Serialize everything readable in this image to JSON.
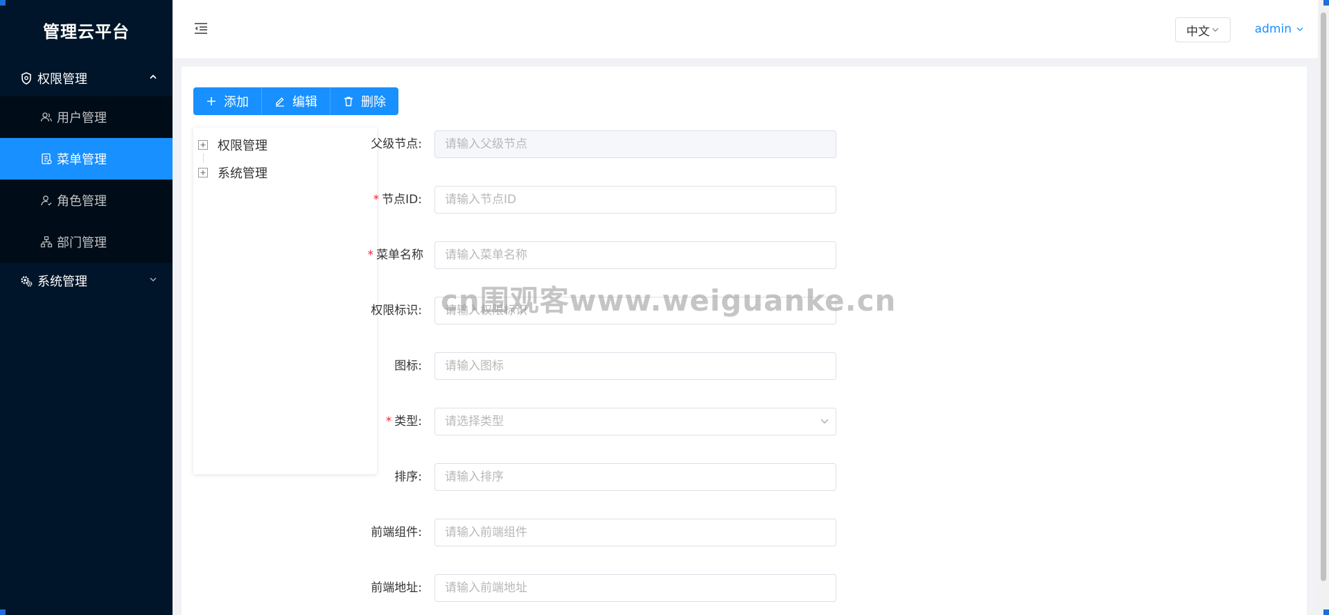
{
  "sidebar": {
    "logo": "管理云平台",
    "groups": [
      {
        "label": "权限管理",
        "icon": "shield-icon",
        "expanded": true,
        "items": [
          {
            "label": "用户管理",
            "icon": "user-icon",
            "active": false
          },
          {
            "label": "菜单管理",
            "icon": "menu-doc-icon",
            "active": true
          },
          {
            "label": "角色管理",
            "icon": "role-icon",
            "active": false
          },
          {
            "label": "部门管理",
            "icon": "org-icon",
            "active": false
          }
        ]
      },
      {
        "label": "系统管理",
        "icon": "gears-icon",
        "expanded": false,
        "items": []
      }
    ]
  },
  "header": {
    "language": "中文",
    "user": "admin"
  },
  "toolbar": {
    "add_label": "添加",
    "edit_label": "编辑",
    "delete_label": "删除"
  },
  "tree": {
    "nodes": [
      {
        "label": "权限管理"
      },
      {
        "label": "系统管理"
      }
    ]
  },
  "form": {
    "fields": [
      {
        "label": "父级节点:",
        "required": false,
        "placeholder": "请输入父级节点",
        "disabled": true
      },
      {
        "label": "节点ID:",
        "required": true,
        "placeholder": "请输入节点ID"
      },
      {
        "label": "菜单名称",
        "required": true,
        "placeholder": "请输入菜单名称"
      },
      {
        "label": "权限标识:",
        "required": false,
        "placeholder": "请输入权限标识"
      },
      {
        "label": "图标:",
        "required": false,
        "placeholder": "请输入图标"
      },
      {
        "label": "类型:",
        "required": true,
        "placeholder": "请选择类型",
        "type": "select"
      },
      {
        "label": "排序:",
        "required": false,
        "placeholder": "请输入排序"
      },
      {
        "label": "前端组件:",
        "required": false,
        "placeholder": "请输入前端组件"
      },
      {
        "label": "前端地址:",
        "required": false,
        "placeholder": "请输入前端地址"
      }
    ]
  },
  "watermark": "cn围观客www.weiguanke.cn",
  "colors": {
    "sidebar_bg": "#001529",
    "submenu_bg": "#000c17",
    "accent": "#1890ff",
    "required": "#f5222d"
  }
}
